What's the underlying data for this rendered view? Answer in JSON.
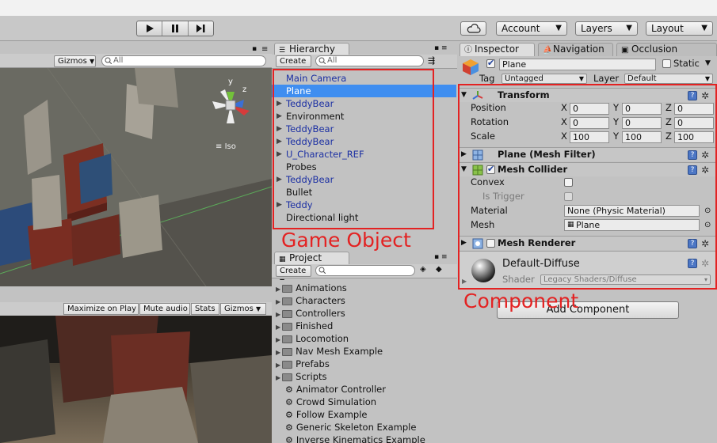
{
  "toolbar": {
    "account_label": "Account",
    "layers_label": "Layers",
    "layout_label": "Layout"
  },
  "scene": {
    "gizmos_label": "Gizmos",
    "search_placeholder": "All",
    "iso_label": "Iso",
    "axis_y": "y",
    "axis_z": "z"
  },
  "game": {
    "maximize_label": "Maximize on Play",
    "mute_label": "Mute audio",
    "stats_label": "Stats",
    "gizmos_label": "Gizmos"
  },
  "hierarchy": {
    "tab_label": "Hierarchy",
    "create_label": "Create",
    "search_placeholder": "All",
    "items": [
      {
        "label": "Main Camera",
        "expandable": false,
        "prefab": true,
        "selected": false
      },
      {
        "label": "Plane",
        "expandable": false,
        "prefab": false,
        "selected": true
      },
      {
        "label": "TeddyBear",
        "expandable": true,
        "prefab": true,
        "selected": false
      },
      {
        "label": "Environment",
        "expandable": true,
        "prefab": false,
        "selected": false
      },
      {
        "label": "TeddyBear",
        "expandable": true,
        "prefab": true,
        "selected": false
      },
      {
        "label": "TeddyBear",
        "expandable": true,
        "prefab": true,
        "selected": false
      },
      {
        "label": "U_Character_REF",
        "expandable": true,
        "prefab": true,
        "selected": false
      },
      {
        "label": "Probes",
        "expandable": false,
        "prefab": false,
        "selected": false
      },
      {
        "label": "TeddyBear",
        "expandable": true,
        "prefab": true,
        "selected": false
      },
      {
        "label": "Bullet",
        "expandable": false,
        "prefab": false,
        "selected": false
      },
      {
        "label": "Teddy",
        "expandable": true,
        "prefab": true,
        "selected": false
      },
      {
        "label": "Directional light",
        "expandable": false,
        "prefab": false,
        "selected": false
      }
    ]
  },
  "project": {
    "tab_label": "Project",
    "create_label": "Create",
    "items": [
      {
        "label": "Animations",
        "type": "folder"
      },
      {
        "label": "Characters",
        "type": "folder"
      },
      {
        "label": "Controllers",
        "type": "folder"
      },
      {
        "label": "Finished",
        "type": "folder"
      },
      {
        "label": "Locomotion",
        "type": "folder"
      },
      {
        "label": "Nav Mesh Example",
        "type": "folder"
      },
      {
        "label": "Prefabs",
        "type": "folder"
      },
      {
        "label": "Scripts",
        "type": "folder"
      },
      {
        "label": "Animator Controller",
        "type": "asset"
      },
      {
        "label": "Crowd Simulation",
        "type": "asset"
      },
      {
        "label": "Follow Example",
        "type": "asset"
      },
      {
        "label": "Generic Skeleton Example",
        "type": "asset"
      },
      {
        "label": "Inverse Kinematics Example",
        "type": "asset"
      }
    ]
  },
  "inspector": {
    "tabs": {
      "inspector": "Inspector",
      "navigation": "Navigation",
      "occlusion": "Occlusion"
    },
    "object_name": "Plane",
    "static_label": "Static",
    "tag_label": "Tag",
    "tag_value": "Untagged",
    "layer_label": "Layer",
    "layer_value": "Default",
    "transform": {
      "title": "Transform",
      "position_label": "Position",
      "rotation_label": "Rotation",
      "scale_label": "Scale",
      "axis_x": "X",
      "axis_y": "Y",
      "axis_z": "Z",
      "position": [
        "0",
        "0",
        "0"
      ],
      "rotation": [
        "0",
        "0",
        "0"
      ],
      "scale": [
        "100",
        "100",
        "100"
      ]
    },
    "mesh_filter_title": "Plane (Mesh Filter)",
    "mesh_collider": {
      "title": "Mesh Collider",
      "convex_label": "Convex",
      "trigger_label": "Is Trigger",
      "material_label": "Material",
      "material_value": "None (Physic Material)",
      "mesh_label": "Mesh",
      "mesh_value": "Plane"
    },
    "mesh_renderer_title": "Mesh Renderer",
    "material_name": "Default-Diffuse",
    "shader_label": "Shader",
    "shader_value": "Legacy Shaders/Diffuse",
    "add_component_label": "Add Component"
  },
  "annotations": {
    "game_object": "Game Object",
    "component": "Component"
  },
  "colors": {
    "accent_red": "#e32222",
    "selection_blue": "#3f8ef0",
    "prefab_blue": "#1b2fa3"
  }
}
